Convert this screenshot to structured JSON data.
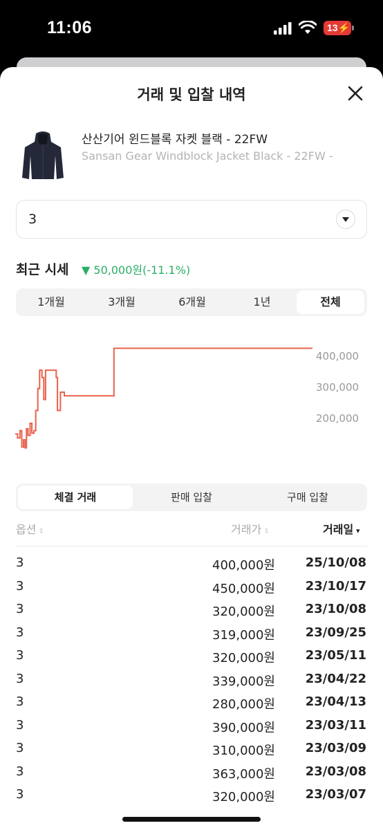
{
  "status": {
    "time": "11:06",
    "battery": "13"
  },
  "sheet": {
    "title": "거래 및 입찰 내역"
  },
  "product": {
    "name_ko": "산산기어 윈드블록 자켓 블랙 - 22FW",
    "name_en": "Sansan Gear Windblock Jacket Black - 22FW -"
  },
  "size_select": {
    "value": "3"
  },
  "recent": {
    "label": "최근 시세",
    "change": "▼ 50,000원(-11.1%)",
    "change_color": "#2bae66"
  },
  "period_tabs": [
    "1개월",
    "3개월",
    "6개월",
    "1년",
    "전체"
  ],
  "period_active": "전체",
  "chart_data": {
    "type": "line",
    "color": "#e8614c",
    "y_ticks": [
      "400,000",
      "300,000",
      "200,000"
    ],
    "ylim": [
      160000,
      500000
    ],
    "x_range": [
      0,
      100
    ],
    "points": [
      [
        0,
        216000
      ],
      [
        0.8,
        216000
      ],
      [
        0.8,
        205000
      ],
      [
        1.6,
        205000
      ],
      [
        1.6,
        225000
      ],
      [
        2.2,
        225000
      ],
      [
        2.2,
        180000
      ],
      [
        2.8,
        180000
      ],
      [
        2.8,
        200000
      ],
      [
        3.3,
        200000
      ],
      [
        3.3,
        178000
      ],
      [
        3.8,
        178000
      ],
      [
        3.8,
        230000
      ],
      [
        4.3,
        230000
      ],
      [
        4.3,
        212000
      ],
      [
        5.0,
        212000
      ],
      [
        5.0,
        245000
      ],
      [
        5.6,
        245000
      ],
      [
        5.6,
        218000
      ],
      [
        6.3,
        218000
      ],
      [
        6.3,
        225000
      ],
      [
        6.9,
        225000
      ],
      [
        6.9,
        280000
      ],
      [
        7.6,
        280000
      ],
      [
        7.6,
        340000
      ],
      [
        8.2,
        340000
      ],
      [
        8.2,
        390000
      ],
      [
        9.0,
        390000
      ],
      [
        9.0,
        370000
      ],
      [
        9.6,
        370000
      ],
      [
        9.6,
        310000
      ],
      [
        10.2,
        310000
      ],
      [
        10.2,
        390000
      ],
      [
        13.8,
        390000
      ],
      [
        13.8,
        370000
      ],
      [
        14.2,
        370000
      ],
      [
        14.2,
        280000
      ],
      [
        15.2,
        280000
      ],
      [
        15.2,
        330000
      ],
      [
        16.5,
        330000
      ],
      [
        16.5,
        320000
      ],
      [
        33.2,
        320000
      ],
      [
        33.2,
        450000
      ],
      [
        100,
        450000
      ]
    ]
  },
  "trade_tabs": [
    "체결 거래",
    "판매 입찰",
    "구매 입찰"
  ],
  "trade_active": "체결 거래",
  "table": {
    "headers": {
      "option": "옵션",
      "price": "거래가",
      "date": "거래일"
    },
    "rows": [
      {
        "option": "3",
        "price": "400,000원",
        "date": "25/10/08"
      },
      {
        "option": "3",
        "price": "450,000원",
        "date": "23/10/17"
      },
      {
        "option": "3",
        "price": "320,000원",
        "date": "23/10/08"
      },
      {
        "option": "3",
        "price": "319,000원",
        "date": "23/09/25"
      },
      {
        "option": "3",
        "price": "320,000원",
        "date": "23/05/11"
      },
      {
        "option": "3",
        "price": "339,000원",
        "date": "23/04/22"
      },
      {
        "option": "3",
        "price": "280,000원",
        "date": "23/04/13"
      },
      {
        "option": "3",
        "price": "390,000원",
        "date": "23/03/11"
      },
      {
        "option": "3",
        "price": "310,000원",
        "date": "23/03/09"
      },
      {
        "option": "3",
        "price": "363,000원",
        "date": "23/03/08"
      },
      {
        "option": "3",
        "price": "320,000원",
        "date": "23/03/07"
      }
    ]
  }
}
